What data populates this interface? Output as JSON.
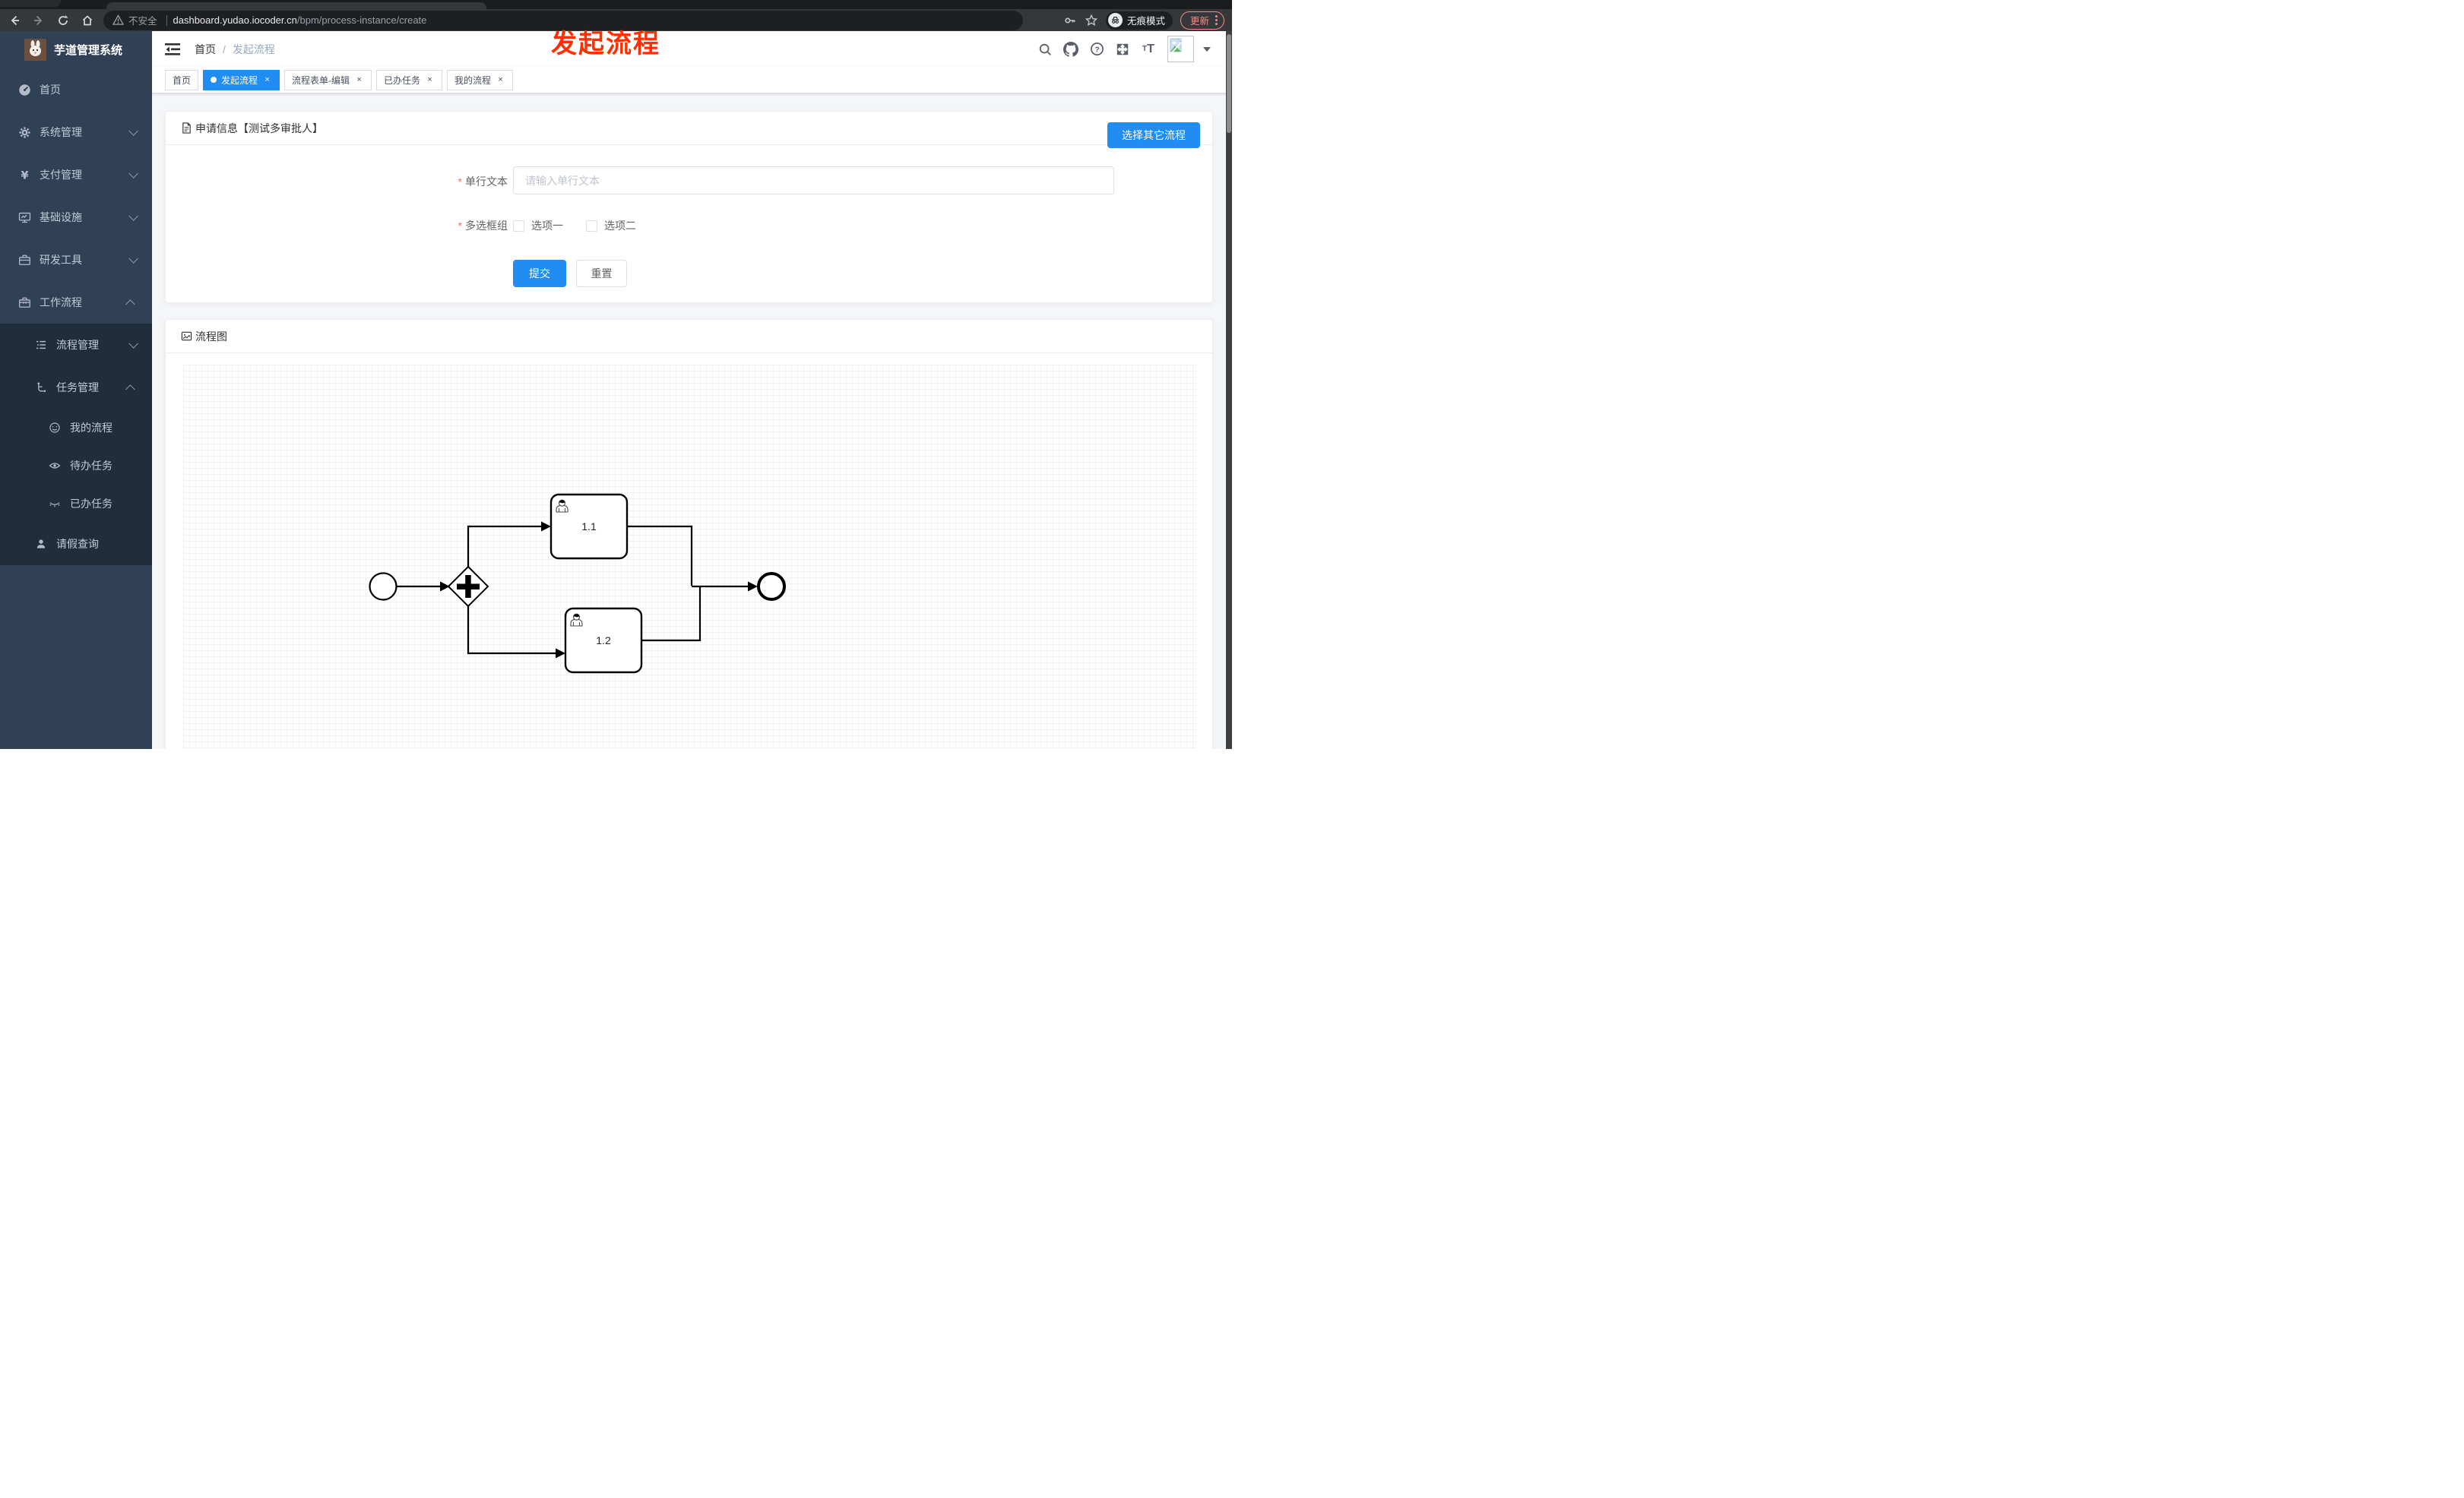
{
  "colors": {
    "primary": "#218cf2",
    "annotation": "#ff3000",
    "sidebar_bg": "#304156",
    "submenu_bg": "#1f2d3d",
    "update": "#f28b82"
  },
  "browser": {
    "security_label": "不安全",
    "url_domain": "dashboard.yudao.iocoder.cn",
    "url_path": "/bpm/process-instance/create",
    "incognito_label": "无痕模式",
    "update_label": "更新"
  },
  "sidebar": {
    "title": "芋道管理系统",
    "items": [
      {
        "label": "首页",
        "icon": "dashboard-icon",
        "level": 1,
        "chevron": null,
        "dark": false
      },
      {
        "label": "系统管理",
        "icon": "gear-icon",
        "level": 1,
        "chevron": "down",
        "dark": false
      },
      {
        "label": "支付管理",
        "icon": "yen-icon",
        "level": 1,
        "chevron": "down",
        "dark": false
      },
      {
        "label": "基础设施",
        "icon": "monitor-icon",
        "level": 1,
        "chevron": "down",
        "dark": false
      },
      {
        "label": "研发工具",
        "icon": "briefcase-icon",
        "level": 1,
        "chevron": "down",
        "dark": false
      },
      {
        "label": "工作流程",
        "icon": "toolbox-icon",
        "level": 1,
        "chevron": "up",
        "dark": false
      },
      {
        "label": "流程管理",
        "icon": "flow-list-icon",
        "level": 2,
        "chevron": "down",
        "dark": true
      },
      {
        "label": "任务管理",
        "icon": "branch-icon",
        "level": 2,
        "chevron": "up",
        "dark": true
      },
      {
        "label": "我的流程",
        "icon": "face-icon",
        "level": 3,
        "chevron": null,
        "dark": true
      },
      {
        "label": "待办任务",
        "icon": "eye-icon",
        "level": 3,
        "chevron": null,
        "dark": true
      },
      {
        "label": "已办任务",
        "icon": "eye-closed-icon",
        "level": 3,
        "chevron": null,
        "dark": true
      },
      {
        "label": "请假查询",
        "icon": "person-icon",
        "level": 2,
        "chevron": null,
        "dark": true
      }
    ]
  },
  "header": {
    "breadcrumb": {
      "home": "首页",
      "sep": "/",
      "current": "发起流程"
    },
    "annotation": "发起流程"
  },
  "tabs": {
    "items": [
      {
        "label": "首页",
        "active": false,
        "closable": false
      },
      {
        "label": "发起流程",
        "active": true,
        "closable": true
      },
      {
        "label": "流程表单-编辑",
        "active": false,
        "closable": true
      },
      {
        "label": "已办任务",
        "active": false,
        "closable": true
      },
      {
        "label": "我的流程",
        "active": false,
        "closable": true
      }
    ]
  },
  "form_card": {
    "title": "申请信息【测试多审批人】",
    "choose_button": "选择其它流程",
    "fields": [
      {
        "label": "单行文本",
        "required": true,
        "placeholder": "请输入单行文本",
        "value": ""
      },
      {
        "label": "多选框组",
        "required": true,
        "options": [
          "选项一",
          "选项二"
        ],
        "checked": [
          false,
          false
        ]
      }
    ],
    "submit_label": "提交",
    "reset_label": "重置"
  },
  "diagram_card": {
    "title": "流程图",
    "nodes": {
      "task1": "1.1",
      "task2": "1.2"
    }
  }
}
